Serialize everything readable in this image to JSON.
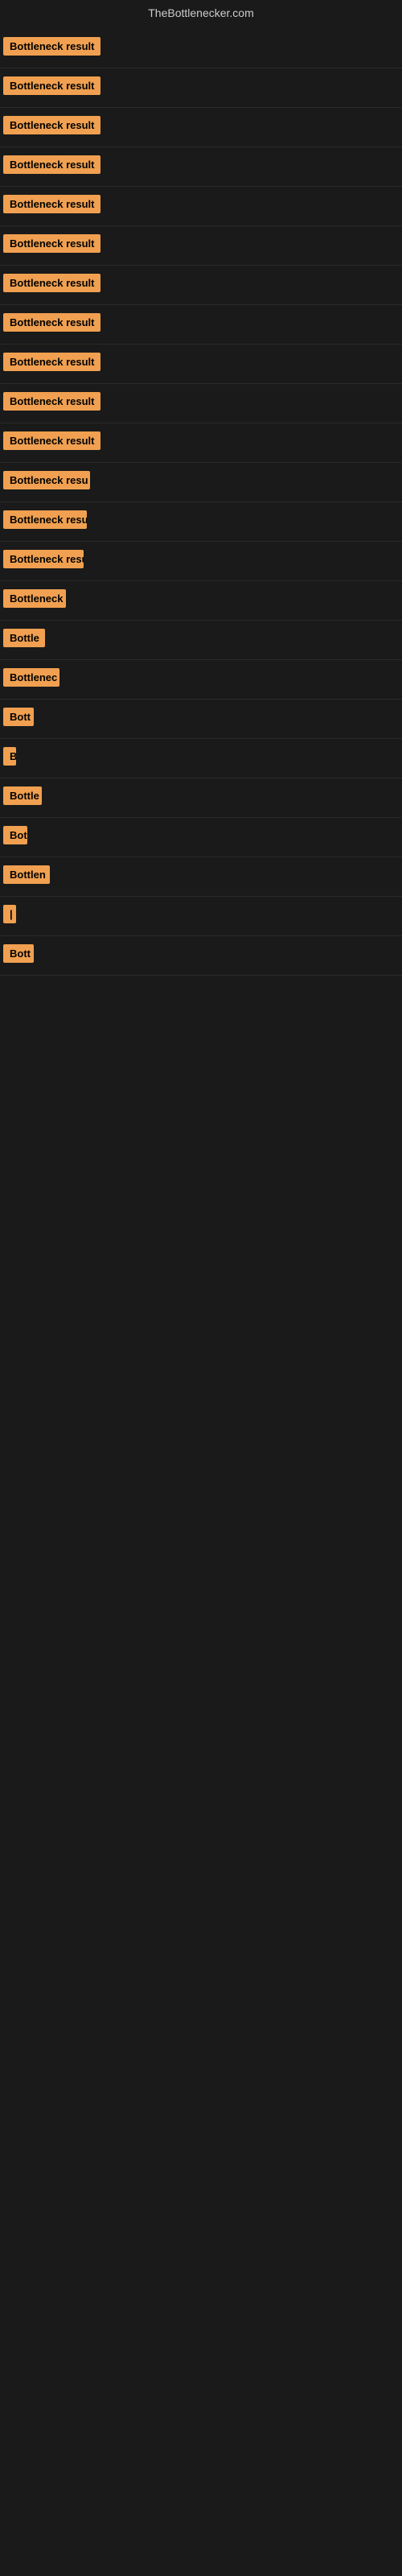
{
  "site": {
    "title": "TheBottlenecker.com"
  },
  "labels": [
    {
      "text": "Bottleneck result",
      "width": 130
    },
    {
      "text": "Bottleneck result",
      "width": 128
    },
    {
      "text": "Bottleneck result",
      "width": 128
    },
    {
      "text": "Bottleneck result",
      "width": 128
    },
    {
      "text": "Bottleneck result",
      "width": 130
    },
    {
      "text": "Bottleneck result",
      "width": 128
    },
    {
      "text": "Bottleneck result",
      "width": 128
    },
    {
      "text": "Bottleneck result",
      "width": 127
    },
    {
      "text": "Bottleneck result",
      "width": 126
    },
    {
      "text": "Bottleneck result",
      "width": 125
    },
    {
      "text": "Bottleneck result",
      "width": 122
    },
    {
      "text": "Bottleneck resu",
      "width": 108
    },
    {
      "text": "Bottleneck resu",
      "width": 104
    },
    {
      "text": "Bottleneck resu",
      "width": 100
    },
    {
      "text": "Bottleneck",
      "width": 78
    },
    {
      "text": "Bottle",
      "width": 52
    },
    {
      "text": "Bottlenec",
      "width": 70
    },
    {
      "text": "Bott",
      "width": 38
    },
    {
      "text": "B",
      "width": 14
    },
    {
      "text": "Bottle",
      "width": 48
    },
    {
      "text": "Bot",
      "width": 30
    },
    {
      "text": "Bottlen",
      "width": 58
    },
    {
      "text": "|",
      "width": 8
    },
    {
      "text": "Bott",
      "width": 38
    }
  ]
}
